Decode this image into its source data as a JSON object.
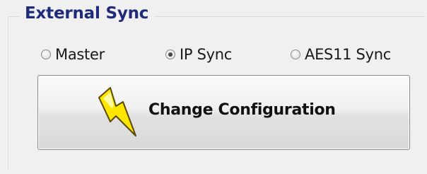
{
  "group": {
    "title": "External Sync"
  },
  "sync_modes": [
    {
      "label": "Master",
      "checked": false
    },
    {
      "label": "IP Sync",
      "checked": true
    },
    {
      "label": "AES11 Sync",
      "checked": false
    }
  ],
  "change_button": {
    "label": "Change Configuration",
    "icon": "lightning-bolt-icon"
  },
  "colors": {
    "group_title": "#1f2a7a",
    "bolt_fill": "#ffe600",
    "bolt_stroke": "#5a4a00"
  }
}
